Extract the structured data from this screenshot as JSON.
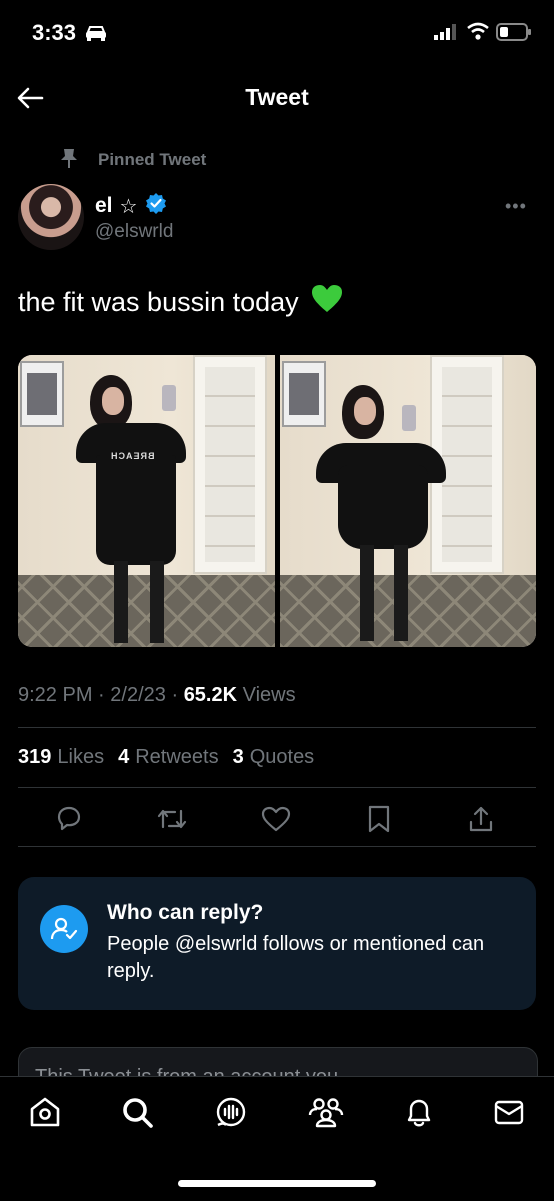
{
  "status_bar": {
    "time": "3:33"
  },
  "nav": {
    "title": "Tweet"
  },
  "tweet": {
    "pinned_label": "Pinned Tweet",
    "display_name": "el",
    "name_symbol": "☆",
    "handle": "@elswrld",
    "text": "the fit was bussin today",
    "emoji": "green-heart",
    "time": "9:22 PM",
    "date": "2/2/23",
    "views_count": "65.2K",
    "views_label": "Views",
    "sep": "·"
  },
  "stats": [
    {
      "count": "319",
      "label": "Likes"
    },
    {
      "count": "4",
      "label": "Retweets"
    },
    {
      "count": "3",
      "label": "Quotes"
    }
  ],
  "actions": [
    "reply-icon",
    "retweet-icon",
    "like-icon",
    "bookmark-icon",
    "share-icon"
  ],
  "reply_card": {
    "title": "Who can reply?",
    "body": "People @elswrld follows or mentioned can reply."
  },
  "notice_card": {
    "text": "This Tweet is from an account you"
  },
  "tab_bar": [
    "home-icon",
    "search-icon",
    "spaces-icon",
    "communities-icon",
    "notifications-icon",
    "messages-icon"
  ],
  "colors": {
    "accent": "#1d9bf0",
    "muted": "#71767b",
    "emoji_green": "#3ccb3c"
  }
}
